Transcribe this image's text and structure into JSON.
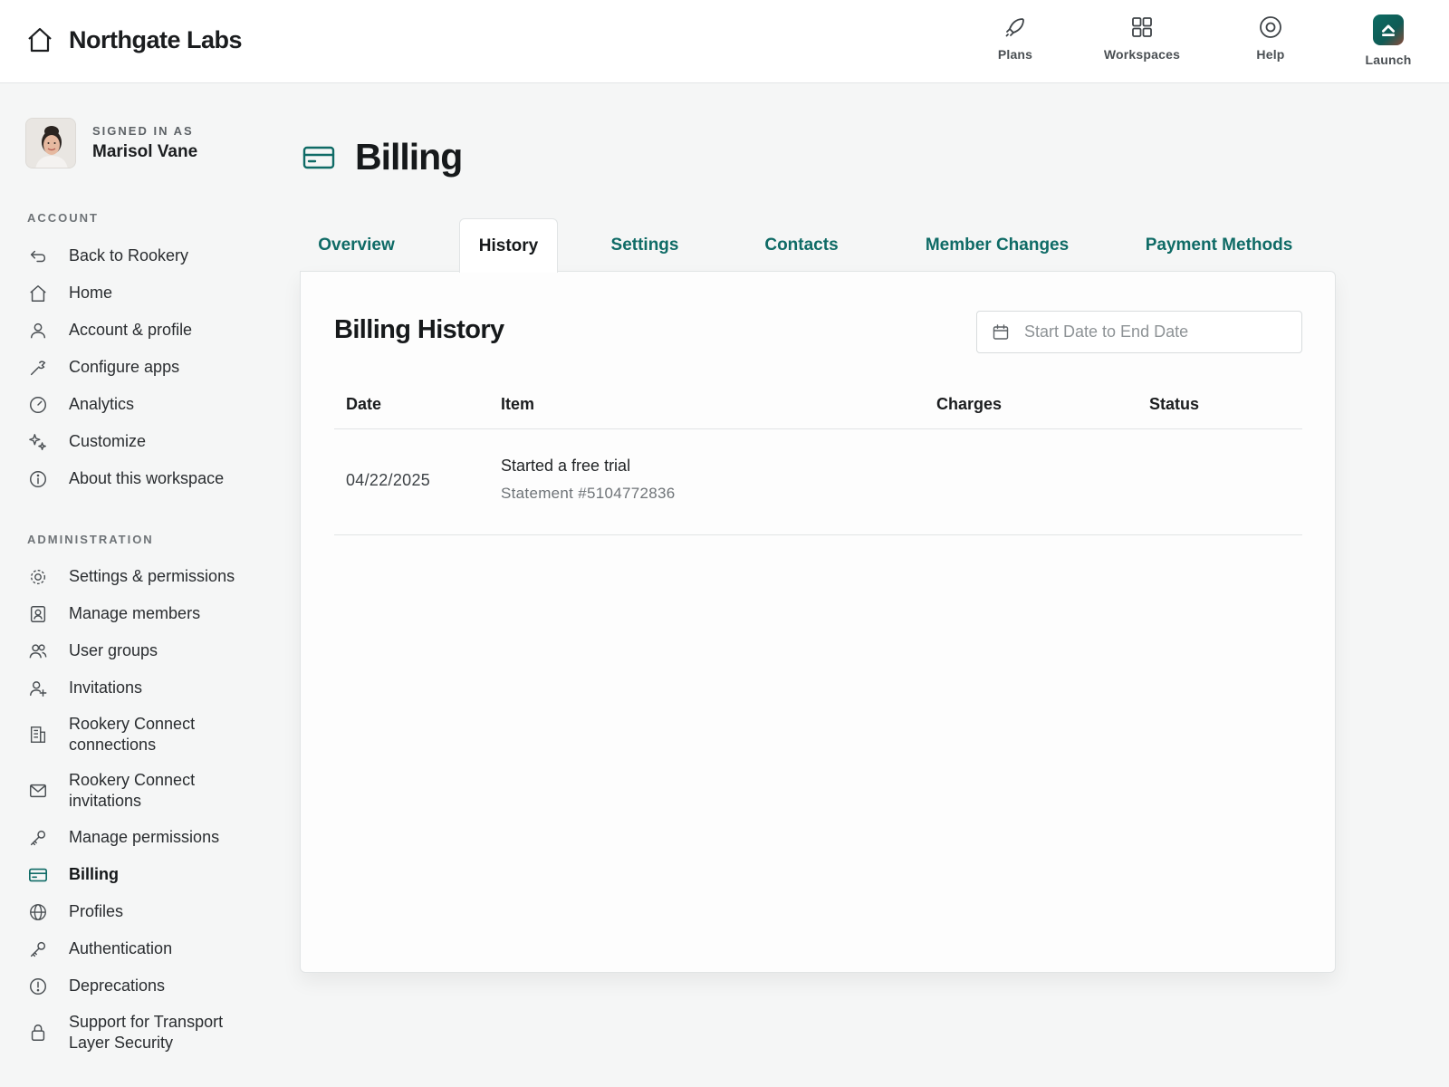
{
  "brand": {
    "name": "Northgate Labs"
  },
  "topnav": {
    "plans": "Plans",
    "workspaces": "Workspaces",
    "help": "Help",
    "launch": "Launch"
  },
  "user": {
    "signed_in_as": "SIGNED IN AS",
    "name": "Marisol Vane"
  },
  "sidebar": {
    "account_heading": "ACCOUNT",
    "account_items": [
      {
        "label": "Back to Rookery",
        "icon": "back-arrow-icon"
      },
      {
        "label": "Home",
        "icon": "home-icon"
      },
      {
        "label": "Account & profile",
        "icon": "user-icon"
      },
      {
        "label": "Configure apps",
        "icon": "wrench-icon"
      },
      {
        "label": "Analytics",
        "icon": "gauge-icon"
      },
      {
        "label": "Customize",
        "icon": "sparkles-icon"
      },
      {
        "label": "About this workspace",
        "icon": "info-icon"
      }
    ],
    "admin_heading": "ADMINISTRATION",
    "admin_items": [
      {
        "label": "Settings & permissions",
        "icon": "gear-icon"
      },
      {
        "label": "Manage members",
        "icon": "member-card-icon"
      },
      {
        "label": "User groups",
        "icon": "users-icon"
      },
      {
        "label": "Invitations",
        "icon": "user-plus-icon"
      },
      {
        "label": "Rookery Connect connections",
        "icon": "building-icon"
      },
      {
        "label": "Rookery Connect invitations",
        "icon": "envelope-icon"
      },
      {
        "label": "Manage permissions",
        "icon": "key-icon"
      },
      {
        "label": "Billing",
        "icon": "credit-card-icon",
        "active": true
      },
      {
        "label": "Profiles",
        "icon": "globe-icon"
      },
      {
        "label": "Authentication",
        "icon": "key-icon"
      },
      {
        "label": "Deprecations",
        "icon": "alert-circle-icon"
      },
      {
        "label": "Support for Transport Layer Security",
        "icon": "lock-icon"
      }
    ]
  },
  "page": {
    "title": "Billing"
  },
  "tabs": [
    {
      "label": "Overview"
    },
    {
      "label": "History",
      "active": true
    },
    {
      "label": "Settings"
    },
    {
      "label": "Contacts"
    },
    {
      "label": "Member Changes"
    },
    {
      "label": "Payment Methods"
    }
  ],
  "history": {
    "title": "Billing History",
    "date_filter": {
      "placeholder": "Start Date to End Date",
      "value": ""
    },
    "columns": [
      "Date",
      "Item",
      "Charges",
      "Status"
    ],
    "rows": [
      {
        "date": "04/22/2025",
        "item": "Started a free trial",
        "statement": "Statement #5104772836",
        "charges": "",
        "status": ""
      }
    ]
  },
  "colors": {
    "accent": "#0f6b66",
    "brand_tile": "#0c6b63",
    "background": "#f5f6f6"
  }
}
